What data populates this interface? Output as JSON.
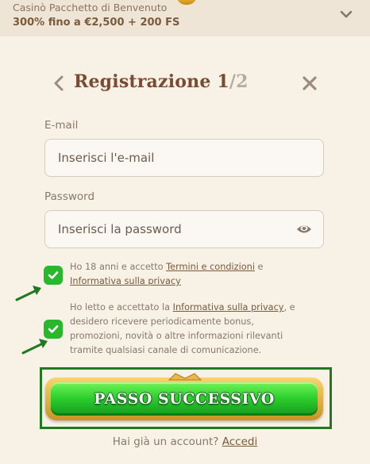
{
  "promo": {
    "title": "Casinò Pacchetto di Benvenuto",
    "offer": "300% fino a €2,500 + 200 FS"
  },
  "header": {
    "title": "Registrazione 1",
    "step_separator": "/",
    "step_total": "2"
  },
  "email": {
    "label": "E-mail",
    "placeholder": "Inserisci l'e-mail",
    "value": ""
  },
  "password": {
    "label": "Password",
    "placeholder": "Inserisci la password",
    "value": ""
  },
  "consent_age": {
    "checked": true,
    "text_1": "Ho 18 anni e accetto ",
    "link_terms": "Termini e condizioni",
    "text_2": " e",
    "link_privacy": "Informativa sulla privacy"
  },
  "consent_marketing": {
    "checked": true,
    "text_1": "Ho letto e accettato la ",
    "link_privacy": "Informativa sulla privacy",
    "text_2": ", e desidero ricevere periodicamente bonus, promozioni, novità o altre informazioni rilevanti tramite qualsiasi canale di comunicazione."
  },
  "cta": {
    "label": "PASSO SUCCESSIVO"
  },
  "footer": {
    "text": "Hai già un account? ",
    "link": "Accedi"
  },
  "colors": {
    "background": "#f7f1e6",
    "title": "#7b4a33",
    "checkbox": "#27b82b",
    "cta_green": "#2ed12f",
    "cta_gold": "#e8b84a",
    "annotation": "#1f7a1f"
  },
  "icons": {
    "back": "chevron-left-icon",
    "close": "close-icon",
    "password_toggle": "eye-icon",
    "expand": "chevron-down-icon",
    "check": "checkmark-icon",
    "annotation": "arrow-icon"
  }
}
